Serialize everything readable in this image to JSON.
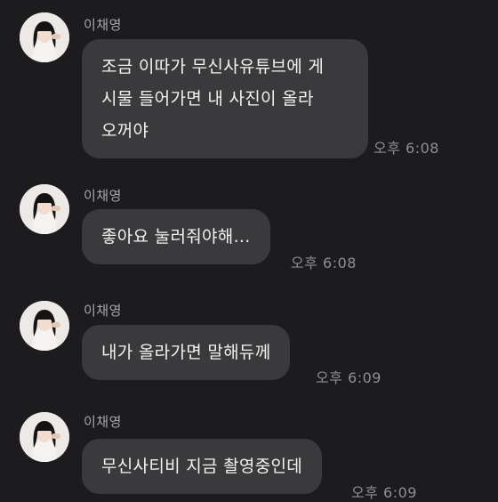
{
  "chat": {
    "messages": [
      {
        "sender": "이채영",
        "text": "조금 이따가 무신사유튜브에 게\n시물 들어가면 내 사진이 올라\n오꺼야",
        "time": "오후 6:08"
      },
      {
        "sender": "이채영",
        "text": "좋아요 눌러줘야해...",
        "time": "오후 6:08"
      },
      {
        "sender": "이채영",
        "text": "내가 올라가면 말해듀께",
        "time": "오후 6:09"
      },
      {
        "sender": "이채영",
        "text": "무신사티비 지금 촬영중인데",
        "time": "오후 6:09"
      }
    ]
  },
  "colors": {
    "background": "#1c1c1e",
    "bubble": "#3a3a3c",
    "sender_text": "#a6a6ab",
    "time_text": "#8e8e93"
  },
  "icons": {
    "avatar": "profile-photo-avatar"
  }
}
